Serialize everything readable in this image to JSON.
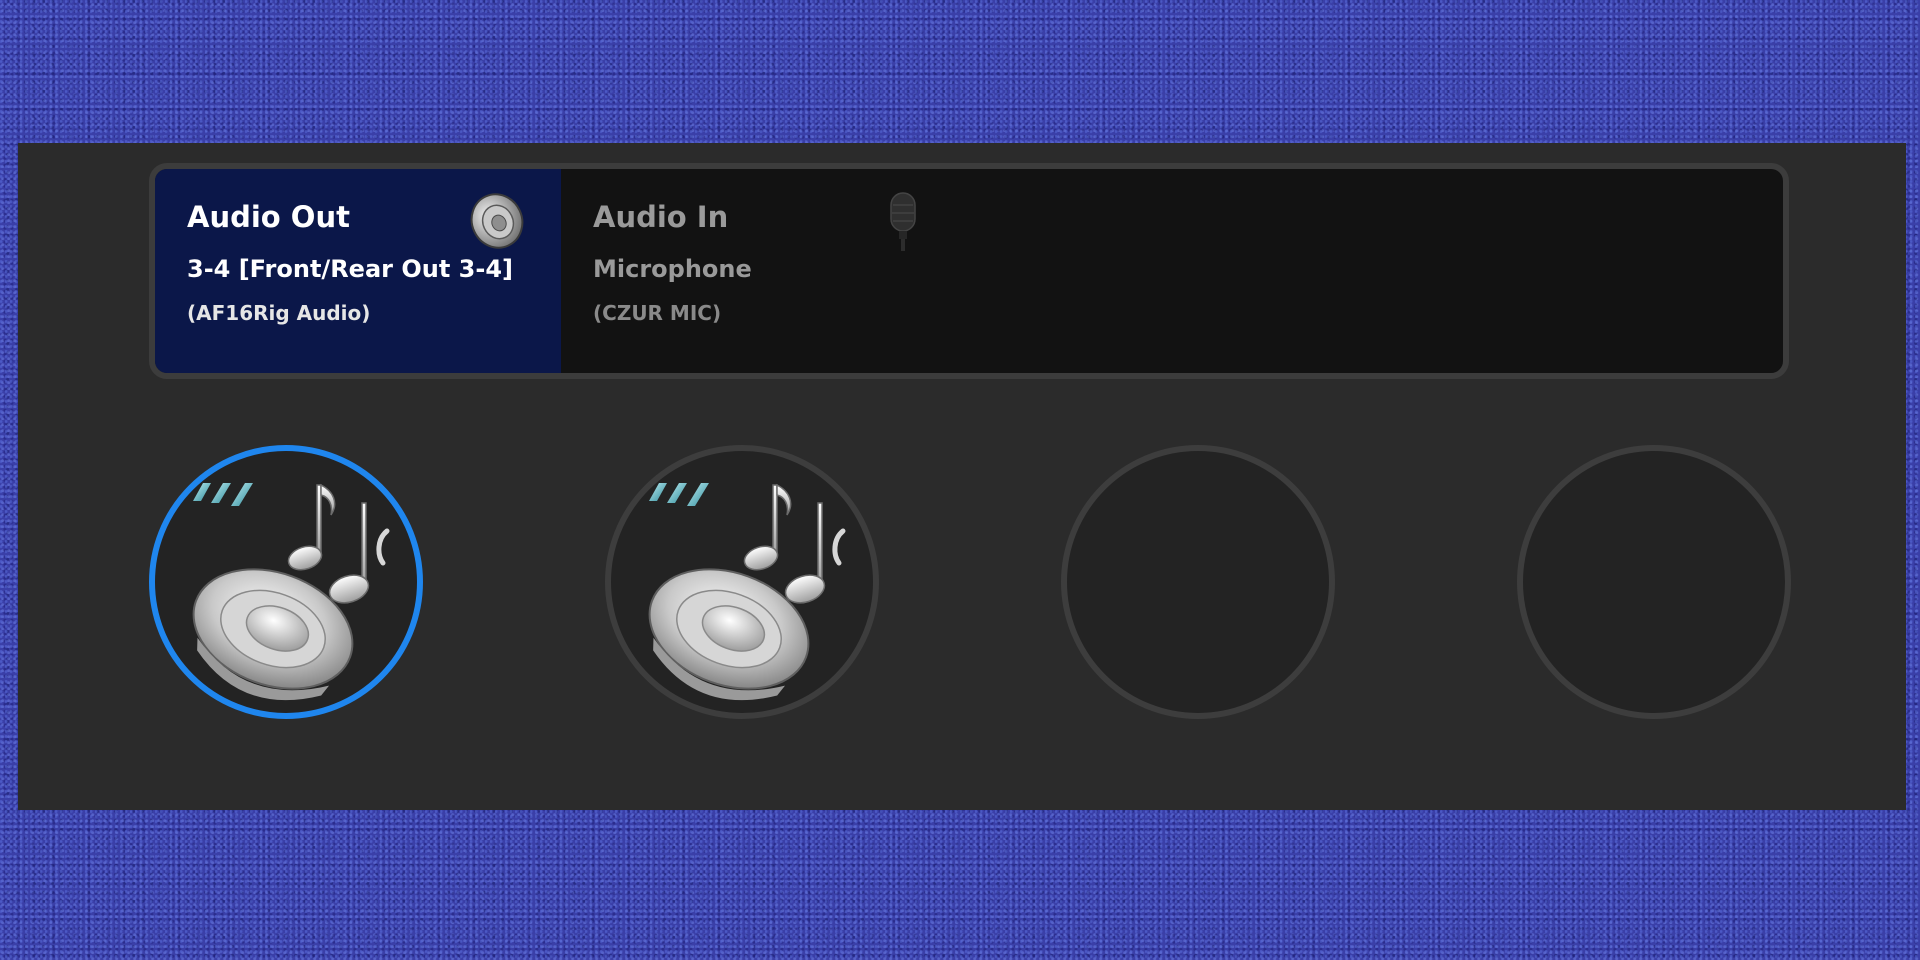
{
  "audio_out": {
    "title": "Audio Out",
    "device": "3-4 [Front/Rear Out 3-4]",
    "subtitle": "(AF16Rig Audio)",
    "icon": "speaker-icon"
  },
  "audio_in": {
    "title": "Audio In",
    "device": "Microphone",
    "subtitle": "(CZUR MIC)",
    "icon": "microphone-icon"
  },
  "slots": [
    {
      "icon": "speaker-music-icon",
      "selected": true
    },
    {
      "icon": "speaker-music-icon",
      "selected": false
    },
    {
      "icon": "",
      "selected": false
    },
    {
      "icon": "",
      "selected": false
    }
  ],
  "colors": {
    "panel": "#2b2b2b",
    "active_tab": "#0b1749",
    "selection_ring": "#1f86ee",
    "background": "#3a3fa8"
  }
}
